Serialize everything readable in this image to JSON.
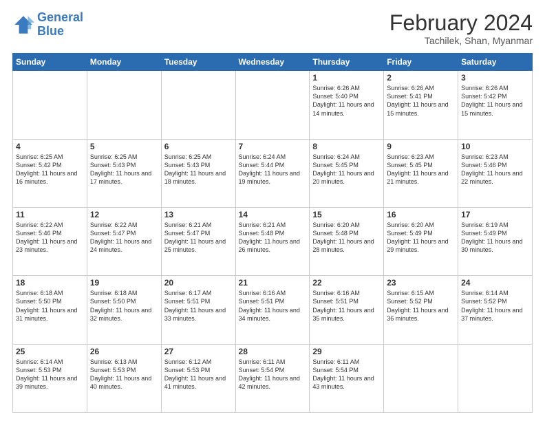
{
  "header": {
    "logo_line1": "General",
    "logo_line2": "Blue",
    "main_title": "February 2024",
    "subtitle": "Tachilek, Shan, Myanmar"
  },
  "days_of_week": [
    "Sunday",
    "Monday",
    "Tuesday",
    "Wednesday",
    "Thursday",
    "Friday",
    "Saturday"
  ],
  "weeks": [
    [
      {
        "day": "",
        "info": ""
      },
      {
        "day": "",
        "info": ""
      },
      {
        "day": "",
        "info": ""
      },
      {
        "day": "",
        "info": ""
      },
      {
        "day": "1",
        "info": "Sunrise: 6:26 AM\nSunset: 5:40 PM\nDaylight: 11 hours and 14 minutes."
      },
      {
        "day": "2",
        "info": "Sunrise: 6:26 AM\nSunset: 5:41 PM\nDaylight: 11 hours and 15 minutes."
      },
      {
        "day": "3",
        "info": "Sunrise: 6:26 AM\nSunset: 5:42 PM\nDaylight: 11 hours and 15 minutes."
      }
    ],
    [
      {
        "day": "4",
        "info": "Sunrise: 6:25 AM\nSunset: 5:42 PM\nDaylight: 11 hours and 16 minutes."
      },
      {
        "day": "5",
        "info": "Sunrise: 6:25 AM\nSunset: 5:43 PM\nDaylight: 11 hours and 17 minutes."
      },
      {
        "day": "6",
        "info": "Sunrise: 6:25 AM\nSunset: 5:43 PM\nDaylight: 11 hours and 18 minutes."
      },
      {
        "day": "7",
        "info": "Sunrise: 6:24 AM\nSunset: 5:44 PM\nDaylight: 11 hours and 19 minutes."
      },
      {
        "day": "8",
        "info": "Sunrise: 6:24 AM\nSunset: 5:45 PM\nDaylight: 11 hours and 20 minutes."
      },
      {
        "day": "9",
        "info": "Sunrise: 6:23 AM\nSunset: 5:45 PM\nDaylight: 11 hours and 21 minutes."
      },
      {
        "day": "10",
        "info": "Sunrise: 6:23 AM\nSunset: 5:46 PM\nDaylight: 11 hours and 22 minutes."
      }
    ],
    [
      {
        "day": "11",
        "info": "Sunrise: 6:22 AM\nSunset: 5:46 PM\nDaylight: 11 hours and 23 minutes."
      },
      {
        "day": "12",
        "info": "Sunrise: 6:22 AM\nSunset: 5:47 PM\nDaylight: 11 hours and 24 minutes."
      },
      {
        "day": "13",
        "info": "Sunrise: 6:21 AM\nSunset: 5:47 PM\nDaylight: 11 hours and 25 minutes."
      },
      {
        "day": "14",
        "info": "Sunrise: 6:21 AM\nSunset: 5:48 PM\nDaylight: 11 hours and 26 minutes."
      },
      {
        "day": "15",
        "info": "Sunrise: 6:20 AM\nSunset: 5:48 PM\nDaylight: 11 hours and 28 minutes."
      },
      {
        "day": "16",
        "info": "Sunrise: 6:20 AM\nSunset: 5:49 PM\nDaylight: 11 hours and 29 minutes."
      },
      {
        "day": "17",
        "info": "Sunrise: 6:19 AM\nSunset: 5:49 PM\nDaylight: 11 hours and 30 minutes."
      }
    ],
    [
      {
        "day": "18",
        "info": "Sunrise: 6:18 AM\nSunset: 5:50 PM\nDaylight: 11 hours and 31 minutes."
      },
      {
        "day": "19",
        "info": "Sunrise: 6:18 AM\nSunset: 5:50 PM\nDaylight: 11 hours and 32 minutes."
      },
      {
        "day": "20",
        "info": "Sunrise: 6:17 AM\nSunset: 5:51 PM\nDaylight: 11 hours and 33 minutes."
      },
      {
        "day": "21",
        "info": "Sunrise: 6:16 AM\nSunset: 5:51 PM\nDaylight: 11 hours and 34 minutes."
      },
      {
        "day": "22",
        "info": "Sunrise: 6:16 AM\nSunset: 5:51 PM\nDaylight: 11 hours and 35 minutes."
      },
      {
        "day": "23",
        "info": "Sunrise: 6:15 AM\nSunset: 5:52 PM\nDaylight: 11 hours and 36 minutes."
      },
      {
        "day": "24",
        "info": "Sunrise: 6:14 AM\nSunset: 5:52 PM\nDaylight: 11 hours and 37 minutes."
      }
    ],
    [
      {
        "day": "25",
        "info": "Sunrise: 6:14 AM\nSunset: 5:53 PM\nDaylight: 11 hours and 39 minutes."
      },
      {
        "day": "26",
        "info": "Sunrise: 6:13 AM\nSunset: 5:53 PM\nDaylight: 11 hours and 40 minutes."
      },
      {
        "day": "27",
        "info": "Sunrise: 6:12 AM\nSunset: 5:53 PM\nDaylight: 11 hours and 41 minutes."
      },
      {
        "day": "28",
        "info": "Sunrise: 6:11 AM\nSunset: 5:54 PM\nDaylight: 11 hours and 42 minutes."
      },
      {
        "day": "29",
        "info": "Sunrise: 6:11 AM\nSunset: 5:54 PM\nDaylight: 11 hours and 43 minutes."
      },
      {
        "day": "",
        "info": ""
      },
      {
        "day": "",
        "info": ""
      }
    ]
  ]
}
